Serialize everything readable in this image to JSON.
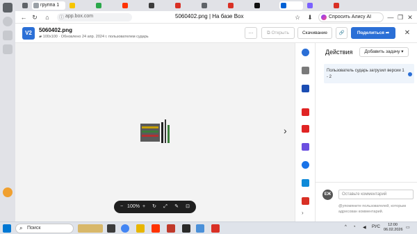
{
  "browser": {
    "tabs": [
      {
        "label": "группа 1",
        "color": "#9aa0a6"
      },
      {
        "label": "",
        "color": "#f7c500"
      },
      {
        "label": "",
        "color": "#2aa84a"
      },
      {
        "label": "",
        "color": "#ff3300"
      },
      {
        "label": "",
        "color": "#3c3c3c"
      },
      {
        "label": "",
        "color": "#d93025"
      },
      {
        "label": "",
        "color": "#5f6368"
      },
      {
        "label": "",
        "color": "#d93025"
      },
      {
        "label": "",
        "color": "#111111"
      },
      {
        "label": "",
        "color": "#0061d5"
      },
      {
        "label": "",
        "color": "#7b61ff"
      },
      {
        "label": "",
        "color": "#d93025"
      }
    ],
    "url": "app.box.com",
    "page_title": "5060402.png | На базе Box",
    "alice_label": "Спросить Алису AI"
  },
  "header": {
    "version": "V2",
    "file_name": "5060402.png",
    "file_meta": "100x100 · Обновлено 24 апр. 2024 г. пользователем сударь",
    "more_label": "···",
    "open_label": "Открыть",
    "download_label": "Скачивание",
    "share_label": "Поделиться"
  },
  "preview": {
    "zoom": "100%",
    "zoom_out": "−",
    "zoom_in": "+"
  },
  "activity": {
    "title": "Действия",
    "add_task": "Добавить задачу",
    "entry": "Пользователь сударь загрузил версии 1 - 2",
    "avatar_initials": "ЕЖ",
    "comment_placeholder": "Оставьте комментарий",
    "comment_hint": "@упомяните пользователей, которым адресован комментарий."
  },
  "taskbar": {
    "search": "Поиск",
    "lang": "РУС",
    "time": "12:00",
    "date": "06.02.2026"
  },
  "colors": {
    "accent": "#2b6fd6"
  }
}
